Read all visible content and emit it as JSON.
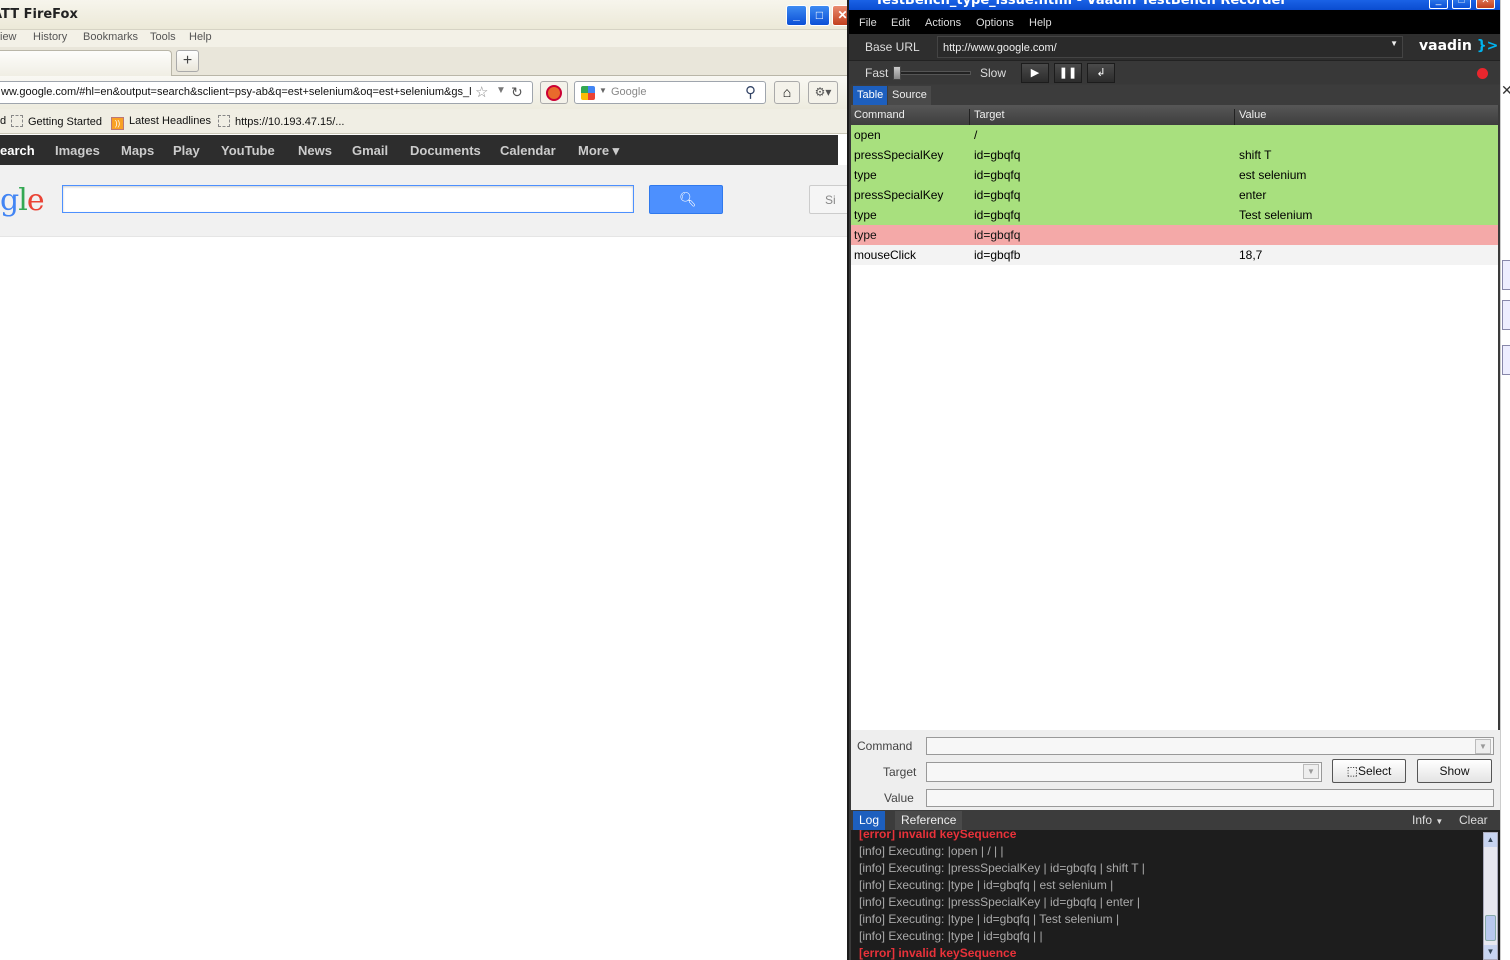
{
  "firefox": {
    "title": "ATT FireFox",
    "menu": [
      "iew",
      "History",
      "Bookmarks",
      "Tools",
      "Help"
    ],
    "url": "ww.google.com/#hl=en&output=search&sclient=psy-ab&q=est+selenium&oq=est+selenium&gs_l",
    "search_placeholder": "Google",
    "bookmarks": [
      {
        "label": "d"
      },
      {
        "label": "Getting Started"
      },
      {
        "label": "Latest Headlines"
      },
      {
        "label": "https://10.193.47.15/..."
      }
    ],
    "new_tab_glyph": "+"
  },
  "google": {
    "nav": [
      "earch",
      "Images",
      "Maps",
      "Play",
      "YouTube",
      "News",
      "Gmail",
      "Documents",
      "Calendar",
      "More ▾"
    ],
    "logo_text": "gle",
    "signin_label": "Si"
  },
  "recorder": {
    "title": "TestBench_type_issue.html - Vaadin TestBench Recorder",
    "menu": [
      "File",
      "Edit",
      "Actions",
      "Options",
      "Help"
    ],
    "base_url_label": "Base URL",
    "base_url_value": "http://www.google.com/",
    "logo": {
      "text": "vaadin",
      "mark": "}>"
    },
    "speed": {
      "fast_label": "Fast",
      "slow_label": "Slow"
    },
    "view_tabs": [
      "Table",
      "Source"
    ],
    "table": {
      "headers": [
        "Command",
        "Target",
        "Value"
      ],
      "rows": [
        {
          "command": "open",
          "target": "/",
          "value": "",
          "status": "ok"
        },
        {
          "command": "pressSpecialKey",
          "target": "id=gbqfq",
          "value": "shift T",
          "status": "ok"
        },
        {
          "command": "type",
          "target": "id=gbqfq",
          "value": "est selenium",
          "status": "ok"
        },
        {
          "command": "pressSpecialKey",
          "target": "id=gbqfq",
          "value": "enter",
          "status": "ok"
        },
        {
          "command": "type",
          "target": "id=gbqfq",
          "value": "Test selenium",
          "status": "ok"
        },
        {
          "command": "type",
          "target": "id=gbqfq",
          "value": "",
          "status": "error"
        },
        {
          "command": "mouseClick",
          "target": "id=gbqfb",
          "value": "18,7",
          "status": "none"
        }
      ]
    },
    "form": {
      "command_label": "Command",
      "target_label": "Target",
      "value_label": "Value",
      "select_button": "Select",
      "show_button": "Show"
    },
    "log_tabs": [
      "Log",
      "Reference"
    ],
    "log_level": "Info",
    "clear_label": "Clear",
    "log": [
      {
        "text": "[error] invalid keySequence",
        "level": "error"
      },
      {
        "text": "[info] Executing: |open | / | |",
        "level": "info"
      },
      {
        "text": "[info] Executing: |pressSpecialKey | id=gbqfq | shift T |",
        "level": "info"
      },
      {
        "text": "[info] Executing: |type | id=gbqfq | est selenium |",
        "level": "info"
      },
      {
        "text": "[info] Executing: |pressSpecialKey | id=gbqfq | enter |",
        "level": "info"
      },
      {
        "text": "[info] Executing: |type | id=gbqfq | Test selenium |",
        "level": "info"
      },
      {
        "text": "[info] Executing: |type | id=gbqfq | |",
        "level": "info"
      },
      {
        "text": "[error] invalid keySequence",
        "level": "error"
      }
    ]
  },
  "colors": {
    "row_ok": "#a8e07e",
    "row_error": "#f4a9a8",
    "log_error": "#e8323a",
    "xp_titlebar": "#0a4cd0"
  }
}
